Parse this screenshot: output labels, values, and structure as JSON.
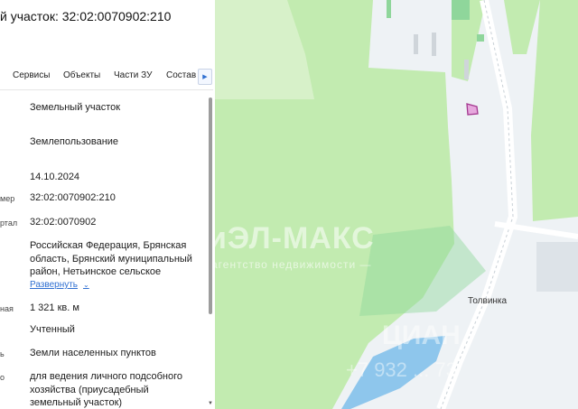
{
  "header": {
    "title": "й участок: 32:02:0070902:210"
  },
  "tabs": [
    {
      "label": "Сервисы"
    },
    {
      "label": "Объекты"
    },
    {
      "label": "Части ЗУ"
    },
    {
      "label": "Состав"
    }
  ],
  "tabs_next_icon": "chevron-right-icon",
  "rows": [
    {
      "label": "",
      "value": "Земельный участок"
    },
    {
      "label": "",
      "value": "Землепользование"
    },
    {
      "label": "",
      "value": "14.10.2024"
    },
    {
      "label": "мер",
      "value": "32:02:0070902:210"
    },
    {
      "label": "ртал",
      "value": "32:02:0070902"
    },
    {
      "label": "",
      "value": "Российская Федерация, Брянская область, Брянский муниципальный район, Нетьинское сельское"
    },
    {
      "label": "ная",
      "value": "1 321 кв. м"
    },
    {
      "label": "",
      "value": "Учтенный"
    },
    {
      "label": "ь",
      "value": "Земли населенных пунктов"
    },
    {
      "label": "о",
      "value": "для ведения личного подсобного хозяйства (приусадебный земельный участок)"
    }
  ],
  "expand_label": "Развернуть",
  "map": {
    "village_label": "Толвинка",
    "watermark_main": "иЭЛ-МАКС",
    "watermark_sub": "агентство недвижимости —",
    "watermark_cian": "ЦИАН",
    "watermark_phone": "+7 932 ... 73",
    "colors": {
      "forest": "#c2ebb0",
      "field": "#eef2f5",
      "road": "#ffffff",
      "water": "#8ec6ec",
      "parcel": "#a3378f"
    }
  }
}
